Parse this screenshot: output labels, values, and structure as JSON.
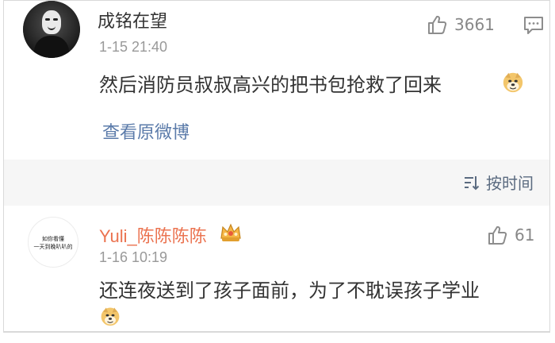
{
  "comments": [
    {
      "username": "成铭在望",
      "timestamp": "1-15 21:40",
      "text": "然后消防员叔叔高兴的把书包抢救了回来",
      "likes": "3661",
      "emoji": "doge",
      "view_original_label": "查看原微博",
      "avatar_icon": "masked-person-avatar"
    },
    {
      "username": "Yuli_陈陈陈陈",
      "timestamp": "1-16 10:19",
      "text": "还连夜送到了孩子面前，为了不耽误孩子学业",
      "likes": "61",
      "emoji": "doge",
      "badge_icon": "crown-badge",
      "avatar_text": [
        "如你看懂",
        "一天到晚叭叭的"
      ]
    }
  ],
  "sort": {
    "label": "按时间",
    "icon": "sort-icon"
  },
  "colors": {
    "username_highlight": "#eb7350",
    "link": "#5b7baa",
    "muted": "#999999",
    "text": "#333333",
    "sort_bg": "#f6f6f6"
  }
}
